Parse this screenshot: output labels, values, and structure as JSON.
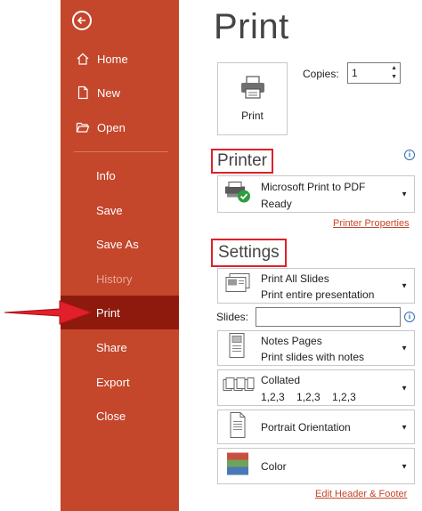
{
  "nav": {
    "home": "Home",
    "new": "New",
    "open": "Open",
    "info": "Info",
    "save": "Save",
    "save_as": "Save As",
    "history": "History",
    "print": "Print",
    "share": "Share",
    "export": "Export",
    "close": "Close"
  },
  "page_title": "Print",
  "print_button": "Print",
  "copies": {
    "label": "Copies:",
    "value": "1"
  },
  "printer": {
    "header": "Printer",
    "name": "Microsoft Print to PDF",
    "status": "Ready",
    "properties_link": "Printer Properties"
  },
  "settings": {
    "header": "Settings",
    "slides_range": {
      "title": "Print All Slides",
      "subtitle": "Print entire presentation"
    },
    "slides_label": "Slides:",
    "slides_value": "",
    "layout": {
      "title": "Notes Pages",
      "subtitle": "Print slides with notes"
    },
    "collation": {
      "title": "Collated",
      "subtitle": "1,2,3    1,2,3    1,2,3"
    },
    "orientation": {
      "title": "Portrait Orientation"
    },
    "color": {
      "title": "Color"
    },
    "header_footer_link": "Edit Header & Footer"
  },
  "colors": {
    "sidebar": "#c4462b",
    "sidebar_selected": "#8e1a0e",
    "highlight_box": "#e0202a",
    "arrow": "#e0202a"
  }
}
